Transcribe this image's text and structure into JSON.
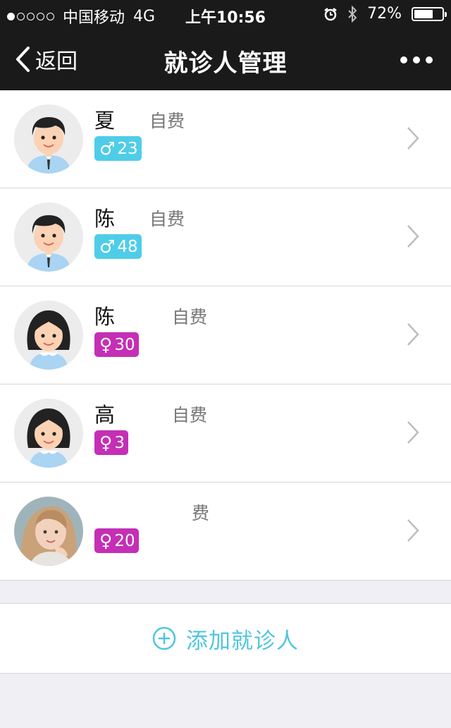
{
  "status": {
    "carrier": "中国移动",
    "network": "4G",
    "time": "上午10:56",
    "battery": "72%",
    "battery_level": 0.72,
    "signal_bars": 1
  },
  "nav": {
    "back_label": "返回",
    "title": "就诊人管理"
  },
  "patients": [
    {
      "name": "夏",
      "pay": "自费",
      "gender": "male",
      "age": "23",
      "avatar": "boy-avatar-icon"
    },
    {
      "name": "陈",
      "pay": "自费",
      "gender": "male",
      "age": "48",
      "avatar": "boy-avatar-icon"
    },
    {
      "name": "陈",
      "pay": "自费",
      "gender": "female",
      "age": "30",
      "avatar": "girl-avatar-icon"
    },
    {
      "name": "高",
      "pay": "自费",
      "gender": "female",
      "age": "3",
      "avatar": "girl-avatar-icon"
    },
    {
      "name": "",
      "pay": "费",
      "gender": "female",
      "age": "20",
      "avatar": "photo-avatar"
    }
  ],
  "add_button": {
    "label": "添加就诊人",
    "icon": "plus-circle-icon"
  },
  "colors": {
    "male": "#4fcde8",
    "female": "#c42fb6",
    "accent": "#4fc5e0",
    "navbar": "#1a1a1a"
  }
}
